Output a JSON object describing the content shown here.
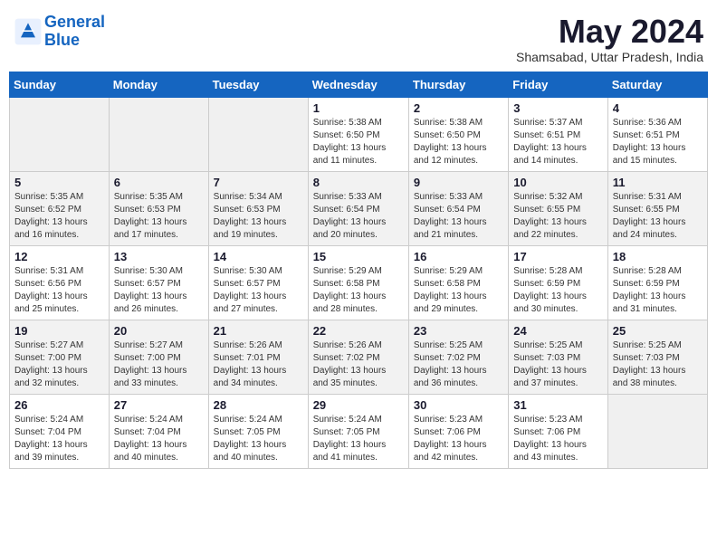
{
  "header": {
    "logo_line1": "General",
    "logo_line2": "Blue",
    "month": "May 2024",
    "location": "Shamsabad, Uttar Pradesh, India"
  },
  "weekdays": [
    "Sunday",
    "Monday",
    "Tuesday",
    "Wednesday",
    "Thursday",
    "Friday",
    "Saturday"
  ],
  "weeks": [
    [
      {
        "day": "",
        "info": ""
      },
      {
        "day": "",
        "info": ""
      },
      {
        "day": "",
        "info": ""
      },
      {
        "day": "1",
        "info": "Sunrise: 5:38 AM\nSunset: 6:50 PM\nDaylight: 13 hours\nand 11 minutes."
      },
      {
        "day": "2",
        "info": "Sunrise: 5:38 AM\nSunset: 6:50 PM\nDaylight: 13 hours\nand 12 minutes."
      },
      {
        "day": "3",
        "info": "Sunrise: 5:37 AM\nSunset: 6:51 PM\nDaylight: 13 hours\nand 14 minutes."
      },
      {
        "day": "4",
        "info": "Sunrise: 5:36 AM\nSunset: 6:51 PM\nDaylight: 13 hours\nand 15 minutes."
      }
    ],
    [
      {
        "day": "5",
        "info": "Sunrise: 5:35 AM\nSunset: 6:52 PM\nDaylight: 13 hours\nand 16 minutes."
      },
      {
        "day": "6",
        "info": "Sunrise: 5:35 AM\nSunset: 6:53 PM\nDaylight: 13 hours\nand 17 minutes."
      },
      {
        "day": "7",
        "info": "Sunrise: 5:34 AM\nSunset: 6:53 PM\nDaylight: 13 hours\nand 19 minutes."
      },
      {
        "day": "8",
        "info": "Sunrise: 5:33 AM\nSunset: 6:54 PM\nDaylight: 13 hours\nand 20 minutes."
      },
      {
        "day": "9",
        "info": "Sunrise: 5:33 AM\nSunset: 6:54 PM\nDaylight: 13 hours\nand 21 minutes."
      },
      {
        "day": "10",
        "info": "Sunrise: 5:32 AM\nSunset: 6:55 PM\nDaylight: 13 hours\nand 22 minutes."
      },
      {
        "day": "11",
        "info": "Sunrise: 5:31 AM\nSunset: 6:55 PM\nDaylight: 13 hours\nand 24 minutes."
      }
    ],
    [
      {
        "day": "12",
        "info": "Sunrise: 5:31 AM\nSunset: 6:56 PM\nDaylight: 13 hours\nand 25 minutes."
      },
      {
        "day": "13",
        "info": "Sunrise: 5:30 AM\nSunset: 6:57 PM\nDaylight: 13 hours\nand 26 minutes."
      },
      {
        "day": "14",
        "info": "Sunrise: 5:30 AM\nSunset: 6:57 PM\nDaylight: 13 hours\nand 27 minutes."
      },
      {
        "day": "15",
        "info": "Sunrise: 5:29 AM\nSunset: 6:58 PM\nDaylight: 13 hours\nand 28 minutes."
      },
      {
        "day": "16",
        "info": "Sunrise: 5:29 AM\nSunset: 6:58 PM\nDaylight: 13 hours\nand 29 minutes."
      },
      {
        "day": "17",
        "info": "Sunrise: 5:28 AM\nSunset: 6:59 PM\nDaylight: 13 hours\nand 30 minutes."
      },
      {
        "day": "18",
        "info": "Sunrise: 5:28 AM\nSunset: 6:59 PM\nDaylight: 13 hours\nand 31 minutes."
      }
    ],
    [
      {
        "day": "19",
        "info": "Sunrise: 5:27 AM\nSunset: 7:00 PM\nDaylight: 13 hours\nand 32 minutes."
      },
      {
        "day": "20",
        "info": "Sunrise: 5:27 AM\nSunset: 7:00 PM\nDaylight: 13 hours\nand 33 minutes."
      },
      {
        "day": "21",
        "info": "Sunrise: 5:26 AM\nSunset: 7:01 PM\nDaylight: 13 hours\nand 34 minutes."
      },
      {
        "day": "22",
        "info": "Sunrise: 5:26 AM\nSunset: 7:02 PM\nDaylight: 13 hours\nand 35 minutes."
      },
      {
        "day": "23",
        "info": "Sunrise: 5:25 AM\nSunset: 7:02 PM\nDaylight: 13 hours\nand 36 minutes."
      },
      {
        "day": "24",
        "info": "Sunrise: 5:25 AM\nSunset: 7:03 PM\nDaylight: 13 hours\nand 37 minutes."
      },
      {
        "day": "25",
        "info": "Sunrise: 5:25 AM\nSunset: 7:03 PM\nDaylight: 13 hours\nand 38 minutes."
      }
    ],
    [
      {
        "day": "26",
        "info": "Sunrise: 5:24 AM\nSunset: 7:04 PM\nDaylight: 13 hours\nand 39 minutes."
      },
      {
        "day": "27",
        "info": "Sunrise: 5:24 AM\nSunset: 7:04 PM\nDaylight: 13 hours\nand 40 minutes."
      },
      {
        "day": "28",
        "info": "Sunrise: 5:24 AM\nSunset: 7:05 PM\nDaylight: 13 hours\nand 40 minutes."
      },
      {
        "day": "29",
        "info": "Sunrise: 5:24 AM\nSunset: 7:05 PM\nDaylight: 13 hours\nand 41 minutes."
      },
      {
        "day": "30",
        "info": "Sunrise: 5:23 AM\nSunset: 7:06 PM\nDaylight: 13 hours\nand 42 minutes."
      },
      {
        "day": "31",
        "info": "Sunrise: 5:23 AM\nSunset: 7:06 PM\nDaylight: 13 hours\nand 43 minutes."
      },
      {
        "day": "",
        "info": ""
      }
    ]
  ]
}
